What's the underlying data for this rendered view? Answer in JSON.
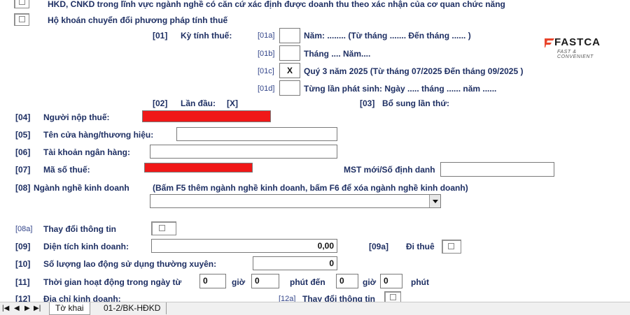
{
  "header": {
    "row_hkd": "HKD, CNKD trong lĩnh vực ngành nghề có căn cứ xác định được doanh thu theo xác nhận của cơ quan chức năng",
    "row_convert": "Hộ khoán chuyển đổi phương pháp tính thuế"
  },
  "tax_period": {
    "code": "[01]",
    "label": "Kỳ tính thuế:",
    "options": [
      {
        "code": "[01a]",
        "mark": "",
        "text": "Năm: ........ (Từ tháng ....... Đến tháng ...... )"
      },
      {
        "code": "[01b]",
        "mark": "",
        "text": "Tháng .... Năm...."
      },
      {
        "code": "[01c]",
        "mark": "X",
        "text": "Quý 3 năm 2025 (Từ  tháng  07/2025  Đến tháng 09/2025 )"
      },
      {
        "code": "[01d]",
        "mark": "",
        "text": "Từng lần phát sinh: Ngày ..... tháng ...... năm ......"
      }
    ]
  },
  "brand": {
    "name": "FASTCA",
    "tagline": "FAST & CONVENIENT"
  },
  "first_time": {
    "code": "[02]",
    "label": "Lần đầu:",
    "value": "[X]"
  },
  "supplement": {
    "code": "[03]",
    "label": "Bổ sung lần thứ:"
  },
  "fields": {
    "f04": {
      "code": "[04]",
      "label": "Người nộp thuế:"
    },
    "f05": {
      "code": "[05]",
      "label": "Tên cửa hàng/thương hiệu:"
    },
    "f06": {
      "code": "[06]",
      "label": "Tài khoản ngân hàng:"
    },
    "f07": {
      "code": "[07]",
      "label": "Mã số thuế:"
    },
    "mst_new": {
      "label": "MST mới/Số định danh"
    },
    "f08": {
      "code": "[08]",
      "label": "Ngành nghề kinh doanh",
      "hint": "(Bấm F5 thêm ngành nghề kinh doanh, bấm F6 để xóa ngành nghề kinh doanh)"
    },
    "f08a": {
      "code": "[08a]",
      "label": "Thay đổi thông tin"
    },
    "f09": {
      "code": "[09]",
      "label": "Diện tích kinh doanh:",
      "value": "0,00"
    },
    "f09a": {
      "code": "[09a]",
      "label": "Đi thuê"
    },
    "f10": {
      "code": "[10]",
      "label": "Số lượng lao động sử dụng thường xuyên:",
      "value": "0"
    },
    "f11": {
      "code": "[11]",
      "label": "Thời gian hoạt động trong ngày từ",
      "from_hour": "0",
      "hour_label": "giờ",
      "from_min": "0",
      "min_to_label": "phút đến",
      "to_hour": "0",
      "hour_label2": "giờ",
      "to_min": "0",
      "min_label": "phút"
    },
    "f12": {
      "code": "[12]",
      "label": "Địa chỉ kinh doanh:"
    },
    "f12a": {
      "code": "[12a]",
      "label": "Thay đổi thông tin"
    }
  },
  "tabs": {
    "nav": [
      "|◀",
      "◀",
      "▶",
      "▶|"
    ],
    "active": "Tờ khai",
    "other": "01-2/BK-HĐKD"
  },
  "colors": {
    "label_text": "#1e2f63",
    "redaction": "#f01818",
    "background": "#ffffff"
  }
}
